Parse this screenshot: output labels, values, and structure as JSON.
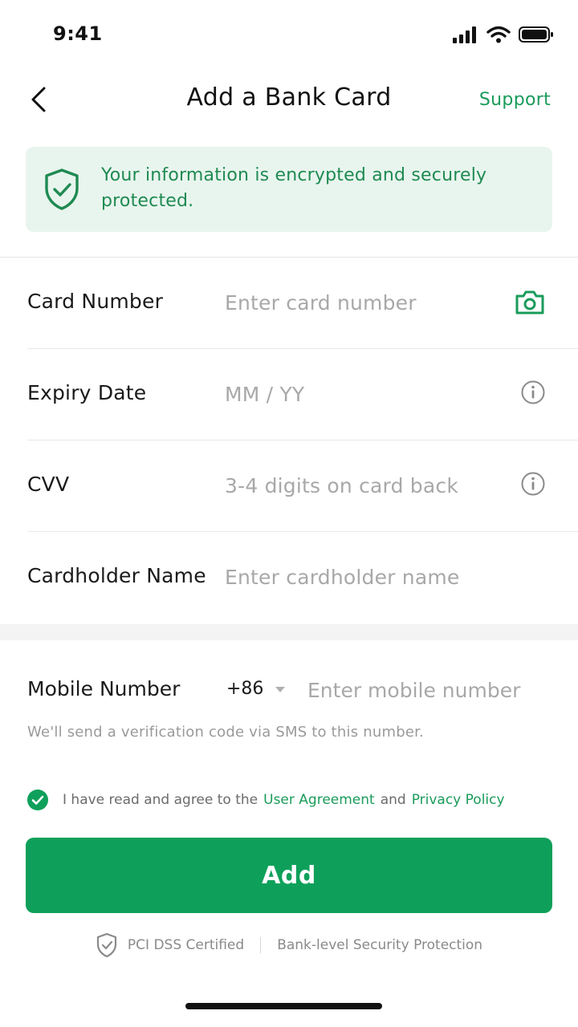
{
  "status_bar": {
    "time": "9:41",
    "icons": [
      "signal-icon",
      "wifi-icon",
      "battery-icon"
    ]
  },
  "nav": {
    "title": "Add a Bank Card",
    "support_label": "Support"
  },
  "notice": {
    "text": "Your information is encrypted and securely protected.",
    "icon": "shield-check-icon"
  },
  "form": {
    "card_number": {
      "label": "Card Number",
      "placeholder": "Enter card number",
      "icon": "camera-icon"
    },
    "expiry_date": {
      "label": "Expiry Date",
      "placeholder": "MM / YY",
      "icon": "info-icon"
    },
    "cvv": {
      "label": "CVV",
      "placeholder": "3-4 digits on card back",
      "icon": "info-icon"
    },
    "cardholder": {
      "label": "Cardholder Name",
      "placeholder": "Enter cardholder name"
    }
  },
  "mobile": {
    "label": "Mobile Number",
    "country_code": "+86",
    "placeholder": "Enter mobile number",
    "hint": "We'll send a verification code via SMS to this number."
  },
  "agreement": {
    "checked": true,
    "prefix": "I have read and agree to the",
    "user_agreement": "User Agreement",
    "conjunction": "and",
    "privacy_policy": "Privacy Policy"
  },
  "actions": {
    "add_label": "Add"
  },
  "footer": {
    "certified": "PCI DSS Certified",
    "security": "Bank-level Security Protection"
  },
  "colors": {
    "accent": "#0ea05a",
    "accent_text": "#1a9b5a",
    "notice_bg": "#e8f5ee"
  }
}
